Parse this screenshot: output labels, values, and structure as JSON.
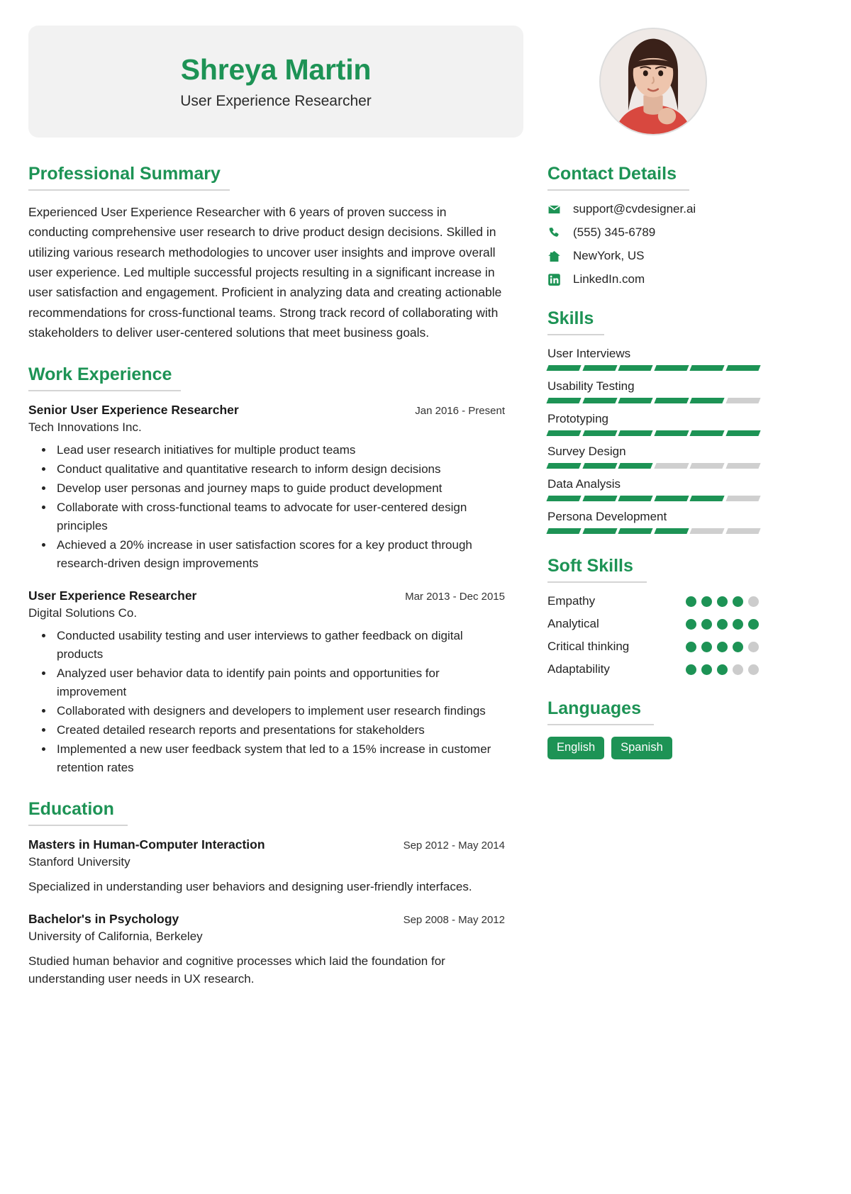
{
  "header": {
    "name": "Shreya Martin",
    "job_title": "User Experience Researcher",
    "avatar_alt": "profile-photo",
    "accent_color": "#1d9355",
    "panel_color": "#f2f2f2"
  },
  "summary": {
    "heading": "Professional Summary",
    "text": "Experienced User Experience Researcher with 6 years of proven success in conducting comprehensive user research to drive product design decisions. Skilled in utilizing various research methodologies to uncover user insights and improve overall user experience. Led multiple successful projects resulting in a significant increase in user satisfaction and engagement. Proficient in analyzing data and creating actionable recommendations for cross-functional teams. Strong track record of collaborating with stakeholders to deliver user-centered solutions that meet business goals."
  },
  "work": {
    "heading": "Work Experience",
    "entries": [
      {
        "title": "Senior User Experience Researcher",
        "date": "Jan 2016 - Present",
        "org": "Tech Innovations Inc.",
        "bullets": [
          "Lead user research initiatives for multiple product teams",
          "Conduct qualitative and quantitative research to inform design decisions",
          "Develop user personas and journey maps to guide product development",
          "Collaborate with cross-functional teams to advocate for user-centered design principles",
          "Achieved a 20% increase in user satisfaction scores for a key product through research-driven design improvements"
        ]
      },
      {
        "title": "User Experience Researcher",
        "date": "Mar 2013 - Dec 2015",
        "org": "Digital Solutions Co.",
        "bullets": [
          "Conducted usability testing and user interviews to gather feedback on digital products",
          "Analyzed user behavior data to identify pain points and opportunities for improvement",
          "Collaborated with designers and developers to implement user research findings",
          "Created detailed research reports and presentations for stakeholders",
          "Implemented a new user feedback system that led to a 15% increase in customer retention rates"
        ]
      }
    ]
  },
  "education": {
    "heading": "Education",
    "entries": [
      {
        "title": "Masters in Human-Computer Interaction",
        "date": "Sep 2012 - May 2014",
        "org": "Stanford University",
        "desc": "Specialized in understanding user behaviors and designing user-friendly interfaces."
      },
      {
        "title": "Bachelor's in Psychology",
        "date": "Sep 2008 - May 2012",
        "org": "University of California, Berkeley",
        "desc": "Studied human behavior and cognitive processes which laid the foundation for understanding user needs in UX research."
      }
    ]
  },
  "contact": {
    "heading": "Contact Details",
    "items": [
      {
        "icon": "envelope-icon",
        "text": "support@cvdesigner.ai"
      },
      {
        "icon": "phone-icon",
        "text": "(555) 345-6789"
      },
      {
        "icon": "home-icon",
        "text": "NewYork, US"
      },
      {
        "icon": "linkedin-icon",
        "text": "LinkedIn.com"
      }
    ]
  },
  "skills": {
    "heading": "Skills",
    "segments_total": 6,
    "items": [
      {
        "label": "User Interviews",
        "level": 6
      },
      {
        "label": "Usability Testing",
        "level": 5
      },
      {
        "label": "Prototyping",
        "level": 6
      },
      {
        "label": "Survey Design",
        "level": 3
      },
      {
        "label": "Data Analysis",
        "level": 5
      },
      {
        "label": "Persona Development",
        "level": 4
      }
    ]
  },
  "soft_skills": {
    "heading": "Soft Skills",
    "dots_total": 5,
    "items": [
      {
        "label": "Empathy",
        "level": 4
      },
      {
        "label": "Analytical",
        "level": 5
      },
      {
        "label": "Critical thinking",
        "level": 4
      },
      {
        "label": "Adaptability",
        "level": 3
      }
    ]
  },
  "languages": {
    "heading": "Languages",
    "items": [
      "English",
      "Spanish"
    ]
  }
}
